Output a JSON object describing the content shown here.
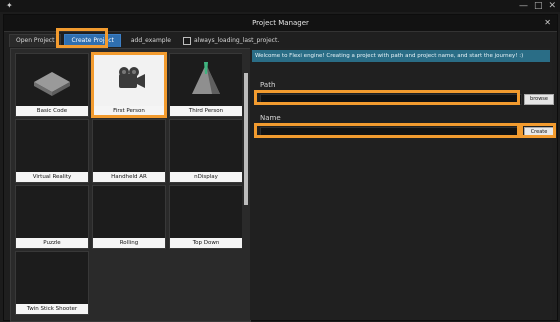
{
  "window": {
    "title": "Project Manager"
  },
  "tabs": [
    {
      "label": "Open Project"
    },
    {
      "label": "Create Project"
    },
    {
      "label": "add_example"
    }
  ],
  "checkbox": {
    "label": "always_loading_last_project."
  },
  "templates": [
    {
      "label": "Basic Code",
      "icon": "platform-icon"
    },
    {
      "label": "First Person",
      "icon": "camera-icon"
    },
    {
      "label": "Third Person",
      "icon": "pyramid-icon"
    },
    {
      "label": "Virtual Reality",
      "icon": ""
    },
    {
      "label": "Handheld AR",
      "icon": ""
    },
    {
      "label": "nDisplay",
      "icon": ""
    },
    {
      "label": "Puzzle",
      "icon": ""
    },
    {
      "label": "Rolling",
      "icon": ""
    },
    {
      "label": "Top Down",
      "icon": ""
    },
    {
      "label": "Twin Stick Shooter",
      "icon": ""
    }
  ],
  "right": {
    "welcome": "Welcome to Flexi engine! Creating a project with path and project name, and start the journey! :)",
    "path_label": "Path",
    "browse_label": "browse",
    "name_label": "Name",
    "create_label": "Create"
  },
  "colors": {
    "highlight": "#f29b2f",
    "active_tab": "#2f6fb0",
    "welcome_bg": "#2a6d86"
  }
}
